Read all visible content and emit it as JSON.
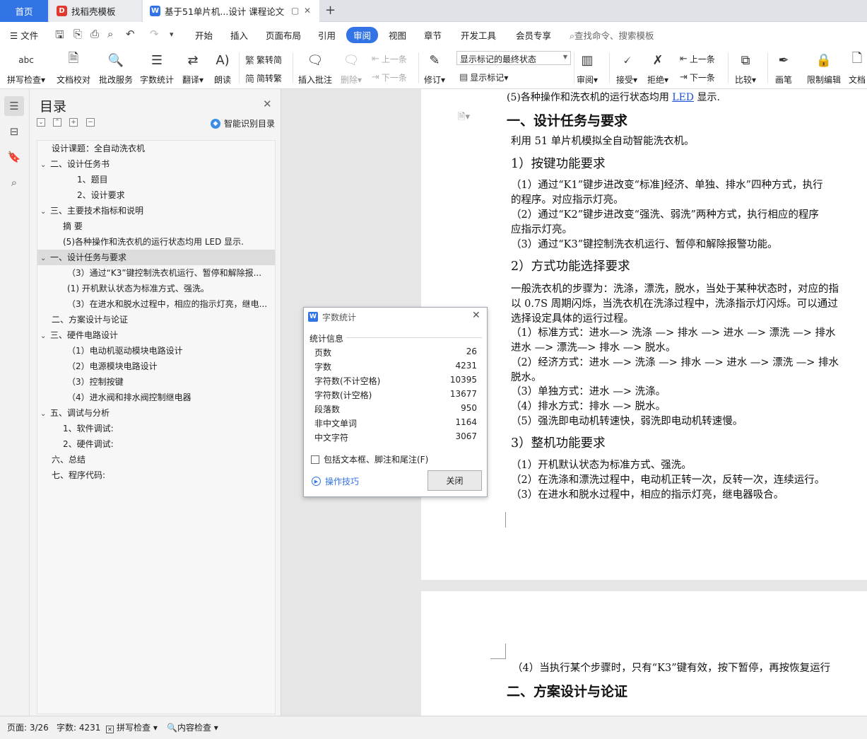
{
  "tabs": {
    "home": "首页",
    "shell": "找稻壳模板",
    "doc": "基于51单片机...设计 课程论文"
  },
  "menu": {
    "file": "文件",
    "items": [
      "开始",
      "插入",
      "页面布局",
      "引用",
      "审阅",
      "视图",
      "章节",
      "开发工具",
      "会员专享"
    ],
    "active": "审阅",
    "search": "查找命令、搜索模板"
  },
  "ribbon": {
    "spell": "拼写检查",
    "proof": "文档校对",
    "batch": "批改服务",
    "wordcount": "字数统计",
    "translate": "翻译",
    "read": "朗读",
    "trad": "繁转简",
    "simp": "简转繁",
    "insert_comment": "插入批注",
    "delete": "删除",
    "prev": "上一条",
    "next": "下一条",
    "revise": "修订",
    "show_mode": "显示标记的最终状态",
    "show_marks": "显示标记",
    "review": "审阅",
    "accept": "接受",
    "reject": "拒绝",
    "prev2": "上一条",
    "next2": "下一条",
    "compare": "比较",
    "pen": "画笔",
    "restrict": "限制编辑",
    "docperm": "文档"
  },
  "toc": {
    "title": "目录",
    "smart": "智能识别目录",
    "items": [
      "设计课题：全自动洗衣机",
      "二、设计任务书",
      "1、题目",
      "2、设计要求",
      "三、主要技术指标和说明",
      "摘  要",
      "(5)各种操作和洗衣机的运行状态均用 LED 显示.",
      "一、设计任务与要求",
      "（3）通过“K3”键控制洗衣机运行、暂停和解除报...",
      "(1) 开机默认状态为标准方式、强洗。",
      "（3）在进水和脱水过程中，相应的指示灯亮，继电...",
      "二、方案设计与论证",
      "三、硬件电路设计",
      "（1）电动机驱动模块电路设计",
      "（2）电源模块电路设计",
      "（3）控制按键",
      "（4）进水阀和排水阀控制继电器",
      "五、调试与分析",
      "1、软件调试:",
      "2、硬件调试:",
      "六、总结",
      "七、程序代码:"
    ]
  },
  "document": {
    "page1": {
      "top_line": "(5)各种操作和洗衣机的运行状态均用 LED 显示.",
      "heading": "一、设计任务与要求",
      "intro": "利用 51 单片机模拟全自动智能洗衣机。",
      "sub1": "1）按键功能要求",
      "sub1_lines": [
        "（1）通过“K1”键步进改变“标准]经济、单独、排水”四种方式，执行",
        "的程序。对应指示灯亮。",
        "（2）通过“K2”键步进改变“强洗、弱洗”两种方式，执行相应的程序",
        "应指示灯亮。",
        "（3）通过“K3”键控制洗衣机运行、暂停和解除报警功能。"
      ],
      "sub2": "2）方式功能选择要求",
      "sub2_lines": [
        "一般洗衣机的步骤为：洗涤，漂洗，脱水，当处于某种状态时，对应的指",
        "以 0.7S 周期闪烁，当洗衣机在洗涤过程中，洗涤指示灯闪烁。可以通过",
        "选择设定具体的运行过程。",
        "（1）标准方式：进水—> 洗涤 —> 排水 —> 进水 —> 漂洗 —> 排水",
        "进水 —> 漂洗—> 排水 —> 脱水。",
        "（2）经济方式：进水 —> 洗涤 —> 排水 —> 进水 —> 漂洗 —> 排水",
        "脱水。",
        "（3）单独方式：进水 —> 洗涤。",
        "（4）排水方式：排水 —> 脱水。",
        "（5）强洗即电动机转速快，弱洗即电动机转速慢。"
      ],
      "sub3": "3）整机功能要求",
      "sub3_lines": [
        "（1）开机默认状态为标准方式、强洗。",
        "（2）在洗涤和漂洗过程中，电动机正转一次，反转一次，连续运行。",
        "（3）在进水和脱水过程中，相应的指示灯亮，继电器吸合。"
      ]
    },
    "page2": {
      "line": "（4）当执行某个步骤时，只有“K3”键有效，按下暂停，再按恢复运行",
      "heading": "二、方案设计与论证"
    }
  },
  "dialog": {
    "title": "字数统计",
    "section": "统计信息",
    "stats": [
      {
        "label": "页数",
        "value": "26"
      },
      {
        "label": "字数",
        "value": "4231"
      },
      {
        "label": "字符数(不计空格)",
        "value": "10395"
      },
      {
        "label": "字符数(计空格)",
        "value": "13677"
      },
      {
        "label": "段落数",
        "value": "950"
      },
      {
        "label": "非中文单词",
        "value": "1164"
      },
      {
        "label": "中文字符",
        "value": "3067"
      }
    ],
    "include": "包括文本框、脚注和尾注(F)",
    "tips": "操作技巧",
    "close": "关闭"
  },
  "status": {
    "page": "页面: 3/26",
    "words": "字数: 4231",
    "spell": "拼写检查",
    "content": "内容检查"
  },
  "colors": {
    "accent": "#3273e6",
    "link": "#1a4fd6"
  }
}
